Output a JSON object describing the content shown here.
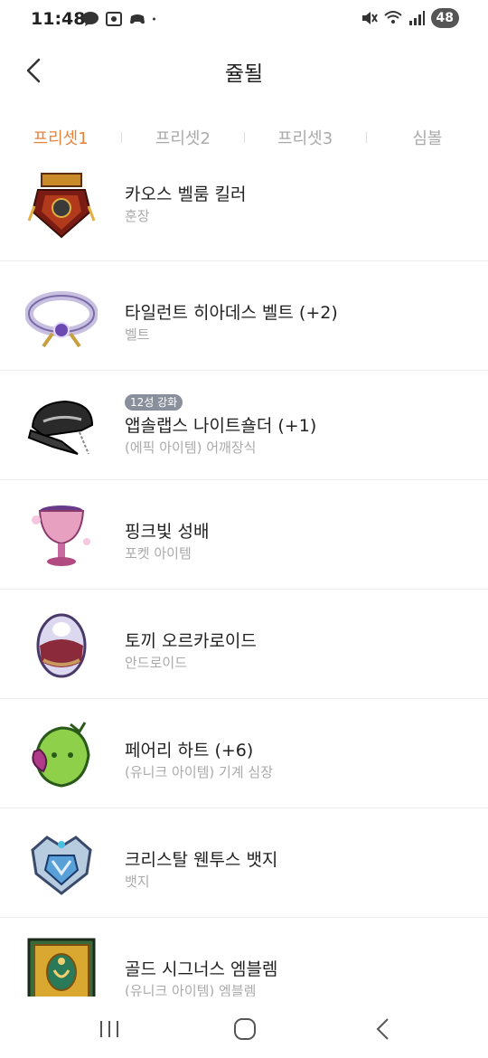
{
  "status": {
    "time": "11:48",
    "battery": "48",
    "left_icons": [
      "talk-icon",
      "screen-icon",
      "game-icon",
      "dot-icon"
    ],
    "right_icons": [
      "mute-icon",
      "wifi-icon",
      "signal-icon"
    ]
  },
  "header": {
    "title": "쥴될",
    "back_icon": "chevron-left-icon"
  },
  "tabs": [
    {
      "label": "프리셋1",
      "active": true
    },
    {
      "label": "프리셋2",
      "active": false
    },
    {
      "label": "프리셋3",
      "active": false
    },
    {
      "label": "심볼",
      "active": false
    }
  ],
  "items": [
    {
      "name": "카오스 벨룸 킬러",
      "sub": "훈장",
      "badge": ""
    },
    {
      "name": "타일런트 히아데스 벨트 (+2)",
      "sub": "벨트",
      "badge": ""
    },
    {
      "name": "앱솔랩스 나이트숄더 (+1)",
      "sub": "(에픽 아이템) 어깨장식",
      "badge": "12성 강화"
    },
    {
      "name": "핑크빛 성배",
      "sub": "포켓 아이템",
      "badge": ""
    },
    {
      "name": "토끼 오르카로이드",
      "sub": "안드로이드",
      "badge": ""
    },
    {
      "name": "페어리 하트 (+6)",
      "sub": "(유니크 아이템) 기계 심장",
      "badge": ""
    },
    {
      "name": "크리스탈 웬투스 뱃지",
      "sub": "뱃지",
      "badge": ""
    },
    {
      "name": "골드 시그너스 엠블렘",
      "sub": "(유니크 아이템) 엠블렘",
      "badge": ""
    }
  ],
  "navbar": {
    "recent_icon": "recent-apps-icon",
    "home_icon": "home-icon",
    "back_icon": "nav-back-icon"
  },
  "colors": {
    "accent": "#e8833a",
    "muted": "#aaaaaa",
    "badge": "#8a8f9c"
  }
}
